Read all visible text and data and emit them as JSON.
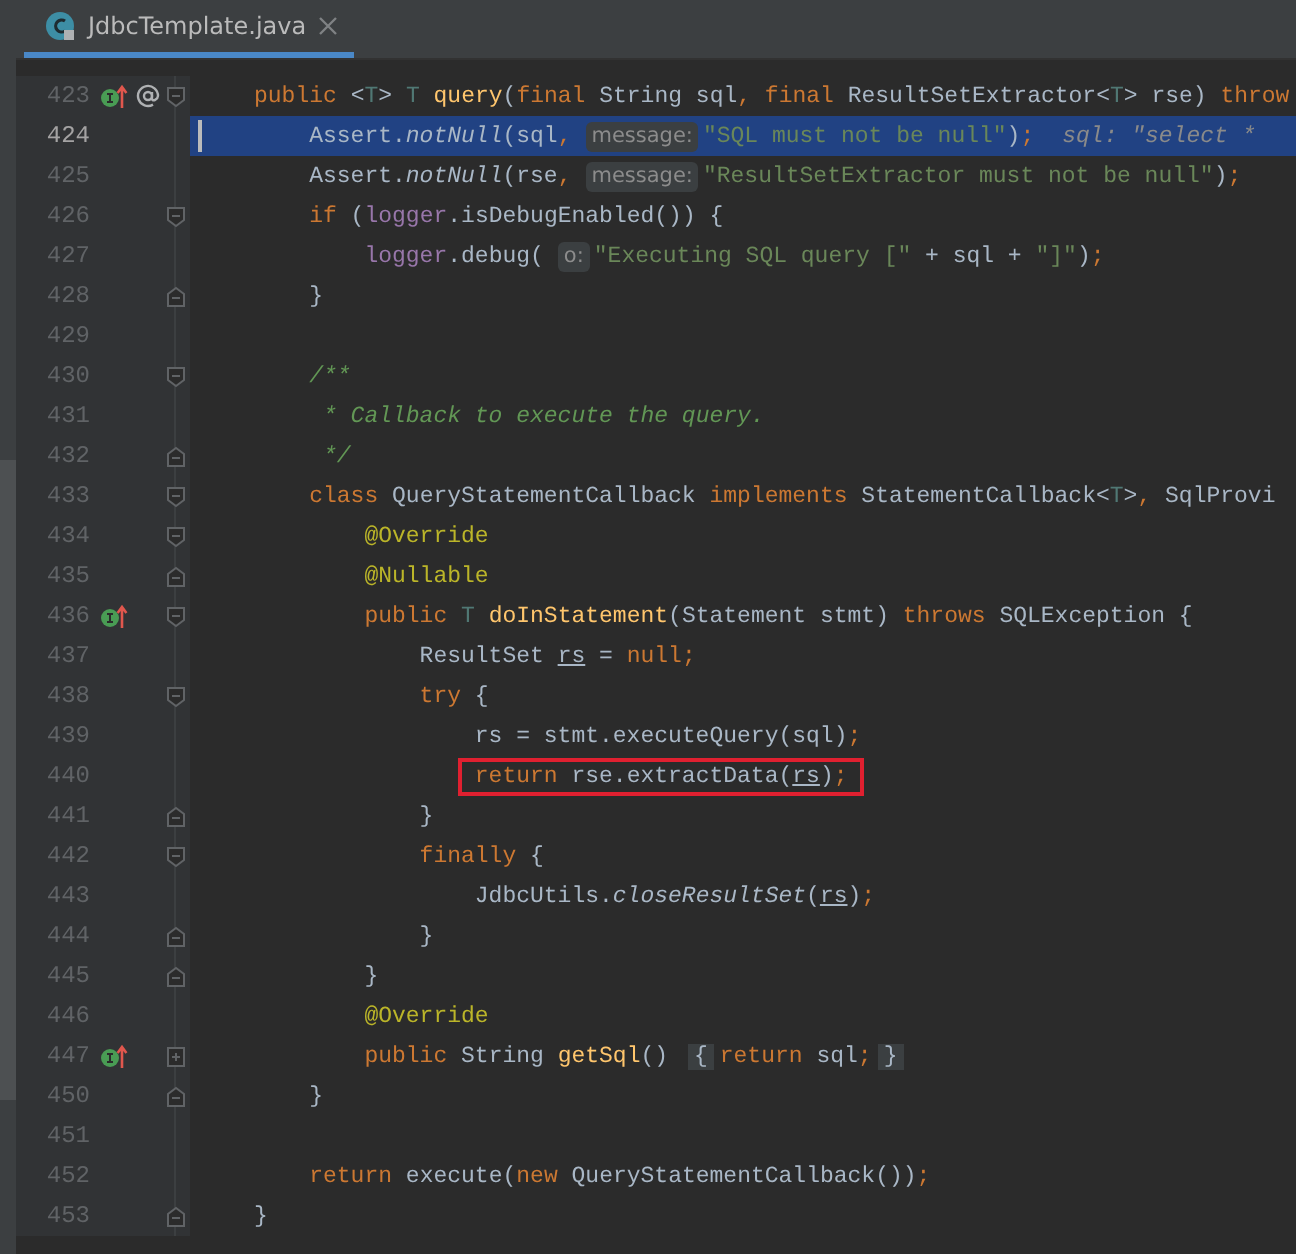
{
  "tab": {
    "title": "JdbcTemplate.java",
    "selected": true
  },
  "lines": [
    {
      "number": "423",
      "fold_start": true,
      "implementation_marker": true,
      "annotation_marker": true,
      "tokens": [
        {
          "kind": "keyword",
          "text": "public"
        },
        {
          "kind": "plain",
          "text": " <"
        },
        {
          "kind": "typeparam",
          "text": "T"
        },
        {
          "kind": "plain",
          "text": "> "
        },
        {
          "kind": "typeparam",
          "text": "T"
        },
        {
          "kind": "method",
          "text": " query"
        },
        {
          "kind": "plain",
          "text": "("
        },
        {
          "kind": "keyword",
          "text": "final"
        },
        {
          "kind": "plain",
          "text": " String sql"
        },
        {
          "kind": "keyword",
          "text": ","
        },
        {
          "kind": "keyword",
          "text": " final"
        },
        {
          "kind": "plain",
          "text": " ResultSetExtractor<"
        },
        {
          "kind": "typeparam",
          "text": "T"
        },
        {
          "kind": "plain",
          "text": "> rse) "
        },
        {
          "kind": "keyword",
          "text": "throw"
        }
      ],
      "children": [
        {
          "number": "424",
          "highlighted": true,
          "tokens": [
            {
              "kind": "plain",
              "text": "Assert."
            },
            {
              "kind": "static",
              "text": "notNull"
            },
            {
              "kind": "plain",
              "text": "(sql"
            },
            {
              "kind": "keyword",
              "text": ","
            },
            {
              "kind": "hint",
              "text": "message:"
            },
            {
              "kind": "string",
              "text": "\"SQL must not be null\""
            },
            {
              "kind": "plain",
              "text": ")"
            },
            {
              "kind": "keyword",
              "text": ";"
            },
            {
              "kind": "debug",
              "text": "sql: \"select *"
            }
          ]
        },
        {
          "number": "425",
          "tokens": [
            {
              "kind": "plain",
              "text": "Assert."
            },
            {
              "kind": "static",
              "text": "notNull"
            },
            {
              "kind": "plain",
              "text": "(rse"
            },
            {
              "kind": "keyword",
              "text": ","
            },
            {
              "kind": "hint",
              "text": "message:"
            },
            {
              "kind": "string",
              "text": "\"ResultSetExtractor must not be null\""
            },
            {
              "kind": "plain",
              "text": ")"
            },
            {
              "kind": "keyword",
              "text": ";"
            }
          ]
        },
        {
          "number": "426",
          "fold_start": true,
          "tokens": [
            {
              "kind": "keyword",
              "text": "if"
            },
            {
              "kind": "plain",
              "text": " ("
            },
            {
              "kind": "field",
              "text": "logger"
            },
            {
              "kind": "plain",
              "text": ".isDebugEnabled()) {"
            }
          ],
          "children": [
            {
              "number": "427",
              "tokens": [
                {
                  "kind": "field",
                  "text": "logger"
                },
                {
                  "kind": "plain",
                  "text": ".debug("
                },
                {
                  "kind": "hint",
                  "text": "o:"
                },
                {
                  "kind": "string",
                  "text": "\"Executing SQL query [\""
                },
                {
                  "kind": "plain",
                  "text": " + sql + "
                },
                {
                  "kind": "string",
                  "text": "\"]\""
                },
                {
                  "kind": "plain",
                  "text": ")"
                },
                {
                  "kind": "keyword",
                  "text": ";"
                }
              ]
            }
          ]
        },
        {
          "number": "428",
          "fold_end": true,
          "tokens": [
            {
              "kind": "plain",
              "text": "}"
            }
          ]
        },
        {
          "number": "429"
        },
        {
          "number": "430",
          "fold_start": true,
          "tokens": [
            {
              "kind": "comment",
              "text": "/**"
            }
          ]
        },
        {
          "number": "431",
          "tokens": [
            {
              "kind": "doccomment",
              "text": "* Callback to execute the query."
            }
          ]
        },
        {
          "number": "432",
          "fold_end": true,
          "tokens": [
            {
              "kind": "doccomment",
              "text": "*/"
            }
          ]
        },
        {
          "number": "433",
          "fold_start": true,
          "tokens": [
            {
              "kind": "keyword",
              "text": "class"
            },
            {
              "kind": "plain",
              "text": " QueryStatementCallback "
            },
            {
              "kind": "keyword",
              "text": "implements"
            },
            {
              "kind": "plain",
              "text": " StatementCallback<"
            },
            {
              "kind": "typeparam",
              "text": "T"
            },
            {
              "kind": "plain",
              "text": ">"
            },
            {
              "kind": "keyword",
              "text": ","
            },
            {
              "kind": "plain",
              "text": " SqlProvi"
            }
          ],
          "children": [
            {
              "number": "434",
              "fold_start": true,
              "tokens": [
                {
                  "kind": "annotation",
                  "text": "@Override"
                }
              ]
            },
            {
              "number": "435",
              "fold_end": true,
              "tokens": [
                {
                  "kind": "annotation",
                  "text": "@Nullable"
                }
              ]
            },
            {
              "number": "436",
              "fold_start": true,
              "implementation_marker": true,
              "tokens": [
                {
                  "kind": "keyword",
                  "text": "public"
                },
                {
                  "kind": "typeparam",
                  "text": " T"
                },
                {
                  "kind": "method",
                  "text": " doInStatement"
                },
                {
                  "kind": "plain",
                  "text": "(Statement stmt) "
                },
                {
                  "kind": "keyword",
                  "text": "throws"
                },
                {
                  "kind": "plain",
                  "text": " SQLException {"
                }
              ],
              "children": [
                {
                  "number": "437",
                  "tokens": [
                    {
                      "kind": "plain",
                      "text": "ResultSet "
                    },
                    {
                      "kind": "local",
                      "text": "rs"
                    },
                    {
                      "kind": "plain",
                      "text": " = "
                    },
                    {
                      "kind": "keyword",
                      "text": "null;"
                    }
                  ]
                },
                {
                  "number": "438",
                  "fold_start": true,
                  "tokens": [
                    {
                      "kind": "keyword",
                      "text": "try"
                    },
                    {
                      "kind": "plain",
                      "text": " {"
                    }
                  ],
                  "children": [
                    {
                      "number": "439",
                      "tokens": [
                        {
                          "kind": "plain",
                          "text": "rs = stmt.executeQuery(sql)"
                        },
                        {
                          "kind": "keyword",
                          "text": ";"
                        }
                      ]
                    },
                    {
                      "number": "440",
                      "boxed": true,
                      "tokens": [
                        {
                          "kind": "keyword",
                          "text": "return"
                        },
                        {
                          "kind": "plain",
                          "text": " rse.extractData("
                        },
                        {
                          "kind": "local",
                          "text": "rs"
                        },
                        {
                          "kind": "plain",
                          "text": ")"
                        },
                        {
                          "kind": "keyword",
                          "text": ";"
                        }
                      ]
                    }
                  ]
                },
                {
                  "number": "441",
                  "fold_end": true,
                  "tokens": [
                    {
                      "kind": "plain",
                      "text": "}"
                    }
                  ]
                },
                {
                  "number": "442",
                  "fold_start": true,
                  "tokens": [
                    {
                      "kind": "keyword",
                      "text": "finally"
                    },
                    {
                      "kind": "plain",
                      "text": " {"
                    }
                  ],
                  "children": [
                    {
                      "number": "443",
                      "tokens": [
                        {
                          "kind": "plain",
                          "text": "JdbcUtils."
                        },
                        {
                          "kind": "static",
                          "text": "closeResultSet"
                        },
                        {
                          "kind": "plain",
                          "text": "("
                        },
                        {
                          "kind": "local",
                          "text": "rs"
                        },
                        {
                          "kind": "plain",
                          "text": ")"
                        },
                        {
                          "kind": "keyword",
                          "text": ";"
                        }
                      ]
                    }
                  ]
                },
                {
                  "number": "444",
                  "fold_end": true,
                  "tokens": [
                    {
                      "kind": "plain",
                      "text": "}"
                    }
                  ]
                }
              ]
            },
            {
              "number": "445",
              "fold_end": true,
              "tokens": [
                {
                  "kind": "plain",
                  "text": "}"
                }
              ]
            },
            {
              "number": "446",
              "tokens": [
                {
                  "kind": "annotation",
                  "text": "@Override"
                }
              ]
            },
            {
              "number": "447",
              "folded": true,
              "implementation_marker": true,
              "tokens": [
                {
                  "kind": "keyword",
                  "text": "public"
                },
                {
                  "kind": "plain",
                  "text": " String "
                },
                {
                  "kind": "method",
                  "text": "getSql"
                },
                {
                  "kind": "plain",
                  "text": "() "
                },
                {
                  "kind": "foldbrace",
                  "text": "{"
                },
                {
                  "kind": "keyword",
                  "text": "return"
                },
                {
                  "kind": "plain",
                  "text": " sql"
                },
                {
                  "kind": "keyword",
                  "text": ";"
                },
                {
                  "kind": "foldbrace",
                  "text": "}"
                }
              ]
            }
          ]
        },
        {
          "number": "450",
          "fold_end": true,
          "tokens": [
            {
              "kind": "plain",
              "text": "}"
            }
          ]
        },
        {
          "number": "451"
        },
        {
          "number": "452",
          "tokens": [
            {
              "kind": "keyword",
              "text": "return"
            },
            {
              "kind": "plain",
              "text": " execute("
            },
            {
              "kind": "keyword",
              "text": "new"
            },
            {
              "kind": "plain",
              "text": " QueryStatementCallback())"
            },
            {
              "kind": "keyword",
              "text": ";"
            }
          ]
        }
      ]
    },
    {
      "number": "453",
      "fold_end": true,
      "tokens": [
        {
          "kind": "plain",
          "text": "}"
        }
      ]
    }
  ]
}
